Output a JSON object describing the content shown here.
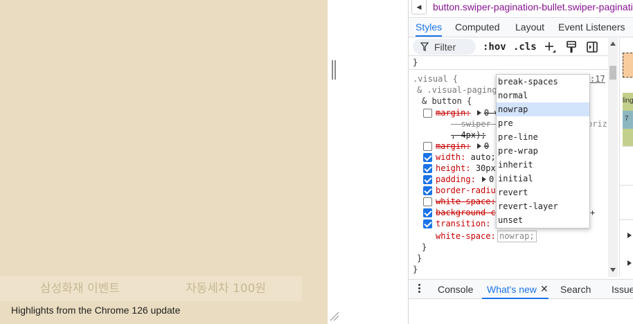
{
  "page": {
    "pagination": [
      "삼성화재 이벤트",
      "자동세차 100원"
    ]
  },
  "devtools": {
    "breadcrumb": "button.swiper-pagination-bullet.swiper-paginati",
    "tabs": [
      "Styles",
      "Computed",
      "Layout",
      "Event Listeners"
    ],
    "active_tab": "Styles",
    "filter_placeholder": "Filter",
    "hov": ":hov",
    "cls": ".cls",
    "rules": {
      "close_brace_top": "}",
      "selector_1": ".visual {",
      "selector_2": "& .visual-paging",
      "selector_3": "& button {",
      "source_link": ":17",
      "decl_1_prop": "margin:",
      "decl_1_val": "0 v",
      "decl_1_var": "--swiper-p",
      "decl_1_var_tail": "oriz",
      "decl_1_cont": ", 4px);",
      "decl_2_prop": "margin:",
      "decl_2_val": "0",
      "decl_3_prop": "width:",
      "decl_3_val": "auto;",
      "decl_4_prop": "height:",
      "decl_4_val": "30px",
      "decl_5_prop": "padding:",
      "decl_5_val": "0",
      "decl_6_prop": "border-radius",
      "decl_7_prop": "white-space:",
      "decl_8_prop": "background-co",
      "decl_8_tail": "+",
      "decl_9_prop": "transition:",
      "decl_10_prop": "white-space:",
      "decl_10_val": "nowrap;",
      "brace_a": "}",
      "brace_b": "}",
      "brace_c": "}"
    },
    "side_partial": [
      "ling",
      "7"
    ],
    "suggestions": [
      "break-spaces",
      "normal",
      "nowrap",
      "pre",
      "pre-line",
      "pre-wrap",
      "inherit",
      "initial",
      "revert",
      "revert-layer",
      "unset"
    ],
    "selected_suggestion": "nowrap",
    "drawer": {
      "tabs": [
        "Console",
        "What's new",
        "Search",
        "Issue"
      ],
      "active_tab": "What's new",
      "content": "Highlights from the Chrome 126 update"
    }
  },
  "colors": {
    "accent": "#1a73e8",
    "page_bg": "#e9dcc0",
    "prop_red": "#c80000",
    "suggestion_highlight": "#d2e3fc"
  }
}
